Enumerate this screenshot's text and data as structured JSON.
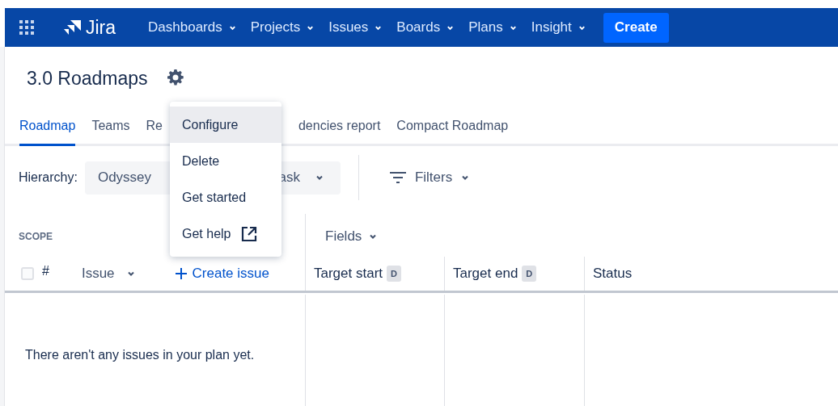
{
  "nav": {
    "product": "Jira",
    "items": [
      "Dashboards",
      "Projects",
      "Issues",
      "Boards",
      "Plans",
      "Insight"
    ],
    "create": "Create"
  },
  "plan": {
    "title": "3.0 Roadmaps"
  },
  "tabs": [
    {
      "label": "Roadmap",
      "selected": true
    },
    {
      "label": "Teams",
      "selected": false
    },
    {
      "label": "Re",
      "selected": false
    },
    {
      "label": "dencies report",
      "selected": false
    },
    {
      "label": "Compact Roadmap",
      "selected": false
    }
  ],
  "hierarchy": {
    "label": "Hierarchy:",
    "from": "Odyssey",
    "to": "ask"
  },
  "filters": "Filters",
  "scope": {
    "heading": "SCOPE",
    "fields": "Fields"
  },
  "columns": [
    {
      "kind": "check",
      "label": "#",
      "checked": false
    },
    {
      "kind": "issue",
      "label": "Issue",
      "action": "Create issue"
    },
    {
      "kind": "date",
      "label": "Target start",
      "badge": "D"
    },
    {
      "kind": "date",
      "label": "Target end",
      "badge": "D"
    },
    {
      "kind": "plain",
      "label": "Status"
    }
  ],
  "empty_message": "There aren't any issues in your plan yet.",
  "menu": [
    {
      "label": "Configure",
      "selected": true,
      "external": false
    },
    {
      "label": "Delete",
      "selected": false,
      "external": false
    },
    {
      "label": "Get started",
      "selected": false,
      "external": false
    },
    {
      "label": "Get help",
      "selected": false,
      "external": true
    }
  ]
}
